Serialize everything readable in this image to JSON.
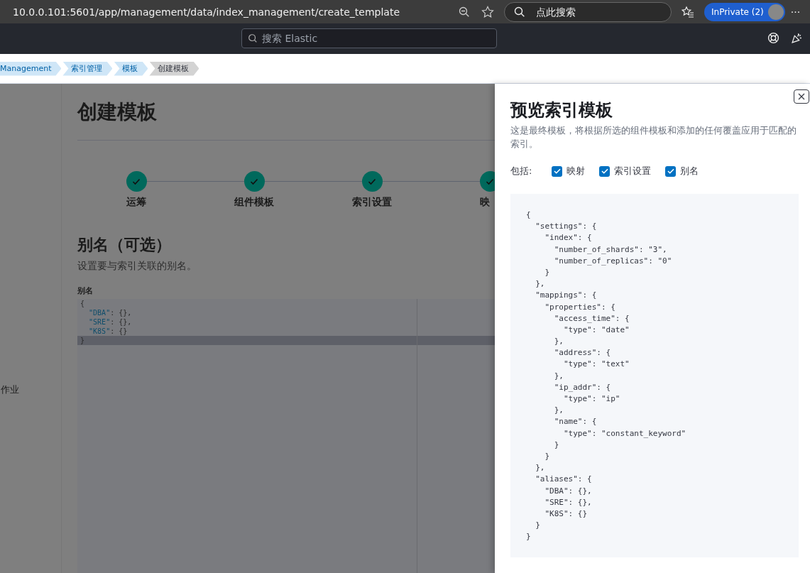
{
  "browser": {
    "url": "10.0.0.101:5601/app/management/data/index_management/create_template",
    "search_placeholder": "点此搜索",
    "profile": "InPrivate (2)",
    "more": "···"
  },
  "header": {
    "search_placeholder": "搜索 Elastic"
  },
  "breadcrumbs": [
    {
      "label": "Management",
      "current": false
    },
    {
      "label": "索引管理",
      "current": false
    },
    {
      "label": "模板",
      "current": false
    },
    {
      "label": "创建模板",
      "current": true
    }
  ],
  "sidebar": {
    "items": [
      "作业"
    ]
  },
  "page": {
    "title": "创建模板",
    "steps": [
      {
        "label": "运筹",
        "done": true
      },
      {
        "label": "组件模板",
        "done": true
      },
      {
        "label": "索引设置",
        "done": true
      },
      {
        "label": "映",
        "done": true
      }
    ],
    "section_title": "别名（可选）",
    "section_description": "设置要与索引关联的别名。",
    "editor_label": "别名",
    "editor_lines": [
      {
        "text": "{",
        "active": false
      },
      {
        "text": "  \"DBA\": {},",
        "active": false
      },
      {
        "text": "  \"SRE\": {},",
        "active": false
      },
      {
        "text": "  \"K8S\": {}",
        "active": false
      },
      {
        "text": "}",
        "active": true
      }
    ]
  },
  "flyout": {
    "title": "预览索引模板",
    "description": "这是最终模板，将根据所选的组件模板和添加的任何覆盖应用于匹配的索引。",
    "include_label": "包括:",
    "options": [
      {
        "label": "映射",
        "checked": true
      },
      {
        "label": "索引设置",
        "checked": true
      },
      {
        "label": "别名",
        "checked": true
      }
    ],
    "code_lines": [
      "{",
      "  \"settings\": {",
      "    \"index\": {",
      "      \"number_of_shards\": \"3\",",
      "      \"number_of_replicas\": \"0\"",
      "    }",
      "  },",
      "  \"mappings\": {",
      "    \"properties\": {",
      "      \"access_time\": {",
      "        \"type\": \"date\"",
      "      },",
      "      \"address\": {",
      "        \"type\": \"text\"",
      "      },",
      "      \"ip_addr\": {",
      "        \"type\": \"ip\"",
      "      },",
      "      \"name\": {",
      "        \"type\": \"constant_keyword\"",
      "      }",
      "    }",
      "  },",
      "  \"aliases\": {",
      "    \"DBA\": {},",
      "    \"SRE\": {},",
      "    \"K8S\": {}",
      "  }",
      "}"
    ]
  }
}
